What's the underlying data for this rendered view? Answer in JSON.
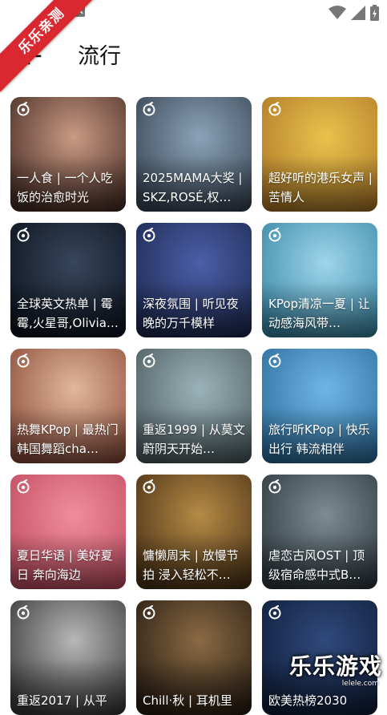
{
  "status": {
    "left_icon": "A"
  },
  "ribbon": {
    "text": "乐乐亲测"
  },
  "header": {
    "title": "流行",
    "back_icon": "arrow-left-icon"
  },
  "playlists": [
    {
      "title": "一人食 | 一个人吃饭的治愈时光",
      "colors": [
        "#c99a84",
        "#4a2f26"
      ]
    },
    {
      "title": "2025MAMA大奖 | SKZ,ROSÉ,权…",
      "colors": [
        "#8aa3b8",
        "#3a4656"
      ]
    },
    {
      "title": "超好听的港乐女声 | 苦情人",
      "colors": [
        "#e9c24c",
        "#b07b2a"
      ]
    },
    {
      "title": "全球英文热单 | 霉霉,火星哥,Olivia…",
      "colors": [
        "#38465c",
        "#0d1420"
      ]
    },
    {
      "title": "深夜氛围 | 听见夜晚的万千模样",
      "colors": [
        "#4b5fa8",
        "#1e2a52"
      ]
    },
    {
      "title": "KPop清凉一夏 | 让动感海风带…",
      "colors": [
        "#9fd5ea",
        "#3b8aa8"
      ]
    },
    {
      "title": "热舞KPop | 最热门韩国舞蹈cha…",
      "colors": [
        "#e2b79c",
        "#8e4f3c"
      ]
    },
    {
      "title": "重返1999 | 从莫文蔚阴天开始…",
      "colors": [
        "#9ab3b8",
        "#4f5f63"
      ]
    },
    {
      "title": "旅行听KPop | 快乐出行 韩流相伴",
      "colors": [
        "#6fb6e6",
        "#2e6f9e"
      ]
    },
    {
      "title": "夏日华语 | 美好夏日 奔向海边",
      "colors": [
        "#ef8e9a",
        "#c24e63"
      ]
    },
    {
      "title": "慵懒周末 | 放慢节拍 浸入轻松不…",
      "colors": [
        "#b58a45",
        "#4d3418"
      ]
    },
    {
      "title": "虐恋古风OST | 顶级宿命感中式B…",
      "colors": [
        "#7d8c93",
        "#2f3a40"
      ]
    },
    {
      "title": "重返2017 | 从平",
      "colors": [
        "#b7b7b7",
        "#3b3b3b"
      ]
    },
    {
      "title": "Chill·秋 | 耳机里",
      "colors": [
        "#8b6a44",
        "#2a1f14"
      ]
    },
    {
      "title": "欧美热榜2030",
      "colors": [
        "#304a7d",
        "#101e3a"
      ]
    }
  ],
  "watermark": {
    "text": "乐乐游戏",
    "sub": "lelele.com"
  }
}
